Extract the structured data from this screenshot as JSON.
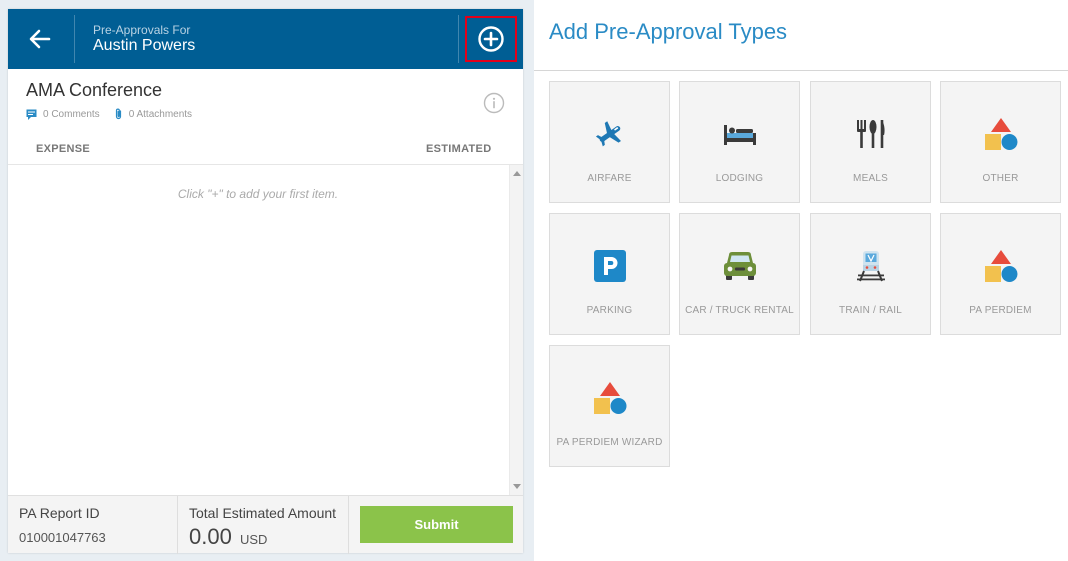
{
  "header": {
    "subtitle": "Pre-Approvals For",
    "title": "Austin Powers"
  },
  "report": {
    "title": "AMA Conference",
    "comments": "0 Comments",
    "attachments": "0 Attachments"
  },
  "table": {
    "col_expense": "EXPENSE",
    "col_estimated": "ESTIMATED",
    "empty_message": "Click \"+\" to add your first item."
  },
  "footer": {
    "report_id_label": "PA Report ID",
    "report_id_value": "010001047763",
    "total_label": "Total Estimated Amount",
    "total_amount": "0.00",
    "currency": "USD",
    "submit_label": "Submit"
  },
  "right": {
    "title": "Add Pre-Approval Types",
    "tiles": [
      {
        "label": "AIRFARE",
        "icon": "airplane-icon"
      },
      {
        "label": "LODGING",
        "icon": "bed-icon"
      },
      {
        "label": "MEALS",
        "icon": "fork-knife-icon"
      },
      {
        "label": "OTHER",
        "icon": "shapes-icon"
      },
      {
        "label": "PARKING",
        "icon": "parking-icon"
      },
      {
        "label": "CAR / TRUCK RENTAL",
        "icon": "car-icon"
      },
      {
        "label": "TRAIN / RAIL",
        "icon": "train-icon"
      },
      {
        "label": "PA PERDIEM",
        "icon": "shapes-icon"
      },
      {
        "label": "PA PERDIEM WIZARD",
        "icon": "shapes-icon"
      }
    ]
  },
  "colors": {
    "header_bg": "#005e94",
    "accent": "#2a8bc5",
    "submit": "#8bc34a",
    "highlight": "#e2001a"
  }
}
